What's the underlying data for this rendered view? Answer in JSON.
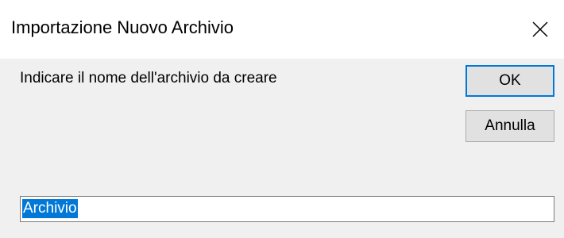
{
  "dialog": {
    "title": "Importazione Nuovo Archivio",
    "close_icon": "close-x-icon",
    "message": "Indicare il nome dell'archivio da creare",
    "ok_label": "OK",
    "cancel_label": "Annulla",
    "input_value": "Archivio",
    "input_selected": true
  },
  "colors": {
    "titlebar": "#ffffff",
    "body": "#f0f0f0",
    "focus_border": "#0078d7",
    "selection": "#0078d7"
  }
}
